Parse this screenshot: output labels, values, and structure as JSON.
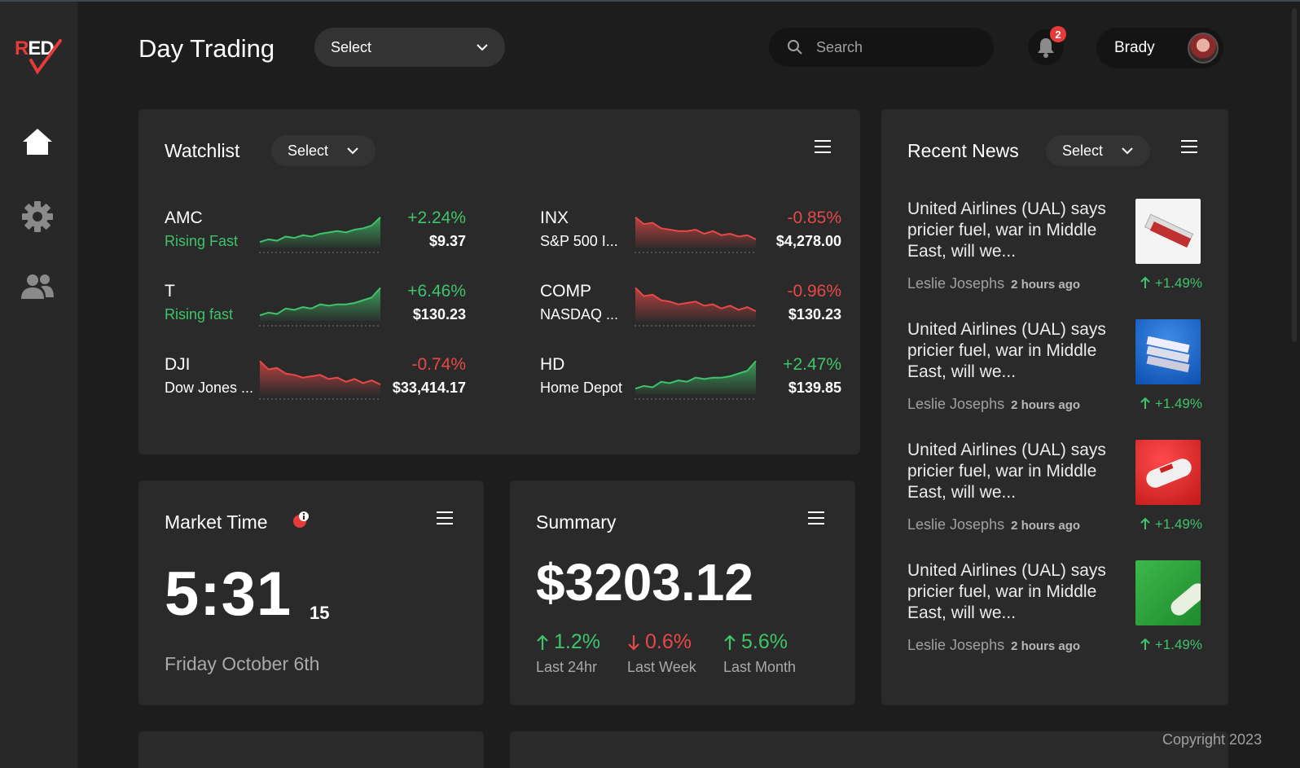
{
  "app": {
    "logo_text": "RED",
    "page_title": "Day Trading",
    "copyright": "Copyright 2023"
  },
  "sidebar": {
    "items": [
      {
        "icon": "home-icon"
      },
      {
        "icon": "gear-icon"
      },
      {
        "icon": "users-icon"
      }
    ]
  },
  "header": {
    "select_label": "Select",
    "search_placeholder": "Search",
    "notifications_count": "2",
    "user_name": "Brady"
  },
  "watchlist": {
    "title": "Watchlist",
    "select_label": "Select",
    "items": [
      {
        "symbol": "AMC",
        "subtitle": "Rising Fast",
        "change": "+2.24%",
        "price": "$9.37",
        "trend": "up",
        "spark": [
          4,
          6,
          5,
          8,
          7,
          9,
          8,
          10,
          11,
          12,
          11,
          13,
          14,
          16,
          22
        ]
      },
      {
        "symbol": "INX",
        "subtitle": "S&P 500 I...",
        "change": "-0.85%",
        "price": "$4,278.00",
        "trend": "down",
        "spark": [
          22,
          17,
          18,
          14,
          13,
          12,
          12,
          13,
          10,
          12,
          9,
          10,
          8,
          9,
          6
        ]
      },
      {
        "symbol": "T",
        "subtitle": "Rising fast",
        "change": "+6.46%",
        "price": "$130.23",
        "trend": "up",
        "spark": [
          4,
          6,
          5,
          9,
          8,
          10,
          9,
          12,
          11,
          12,
          12,
          13,
          15,
          17,
          24
        ]
      },
      {
        "symbol": "COMP",
        "subtitle": "NASDAQ ...",
        "change": "-0.96%",
        "price": "$130.23",
        "trend": "down",
        "spark": [
          24,
          18,
          19,
          15,
          14,
          12,
          13,
          14,
          11,
          12,
          9,
          11,
          8,
          10,
          7
        ]
      },
      {
        "symbol": "DJI",
        "subtitle": "Dow Jones ...",
        "change": "-0.74%",
        "price": "$33,414.17",
        "trend": "down",
        "spark": [
          24,
          18,
          19,
          15,
          14,
          12,
          13,
          14,
          11,
          12,
          9,
          11,
          8,
          10,
          7
        ]
      },
      {
        "symbol": "HD",
        "subtitle": "Home Depot",
        "change": "+2.47%",
        "price": "$139.85",
        "trend": "up",
        "spark": [
          4,
          6,
          5,
          9,
          8,
          10,
          9,
          12,
          11,
          12,
          12,
          13,
          15,
          17,
          24
        ]
      }
    ]
  },
  "market_time": {
    "title": "Market Time",
    "time": "5:31",
    "seconds": "15",
    "date": "Friday October 6th"
  },
  "summary": {
    "title": "Summary",
    "total": "$3203.12",
    "stats": [
      {
        "value": "1.2%",
        "label": "Last 24hr",
        "direction": "up"
      },
      {
        "value": "0.6%",
        "label": "Last Week",
        "direction": "down"
      },
      {
        "value": "5.6%",
        "label": "Last Month",
        "direction": "up"
      }
    ]
  },
  "news": {
    "title": "Recent News",
    "select_label": "Select",
    "items": [
      {
        "headline": "United Airlines (UAL) says pricier fuel, war in Middle East, will we...",
        "author": "Leslie Josephs",
        "time": "2 hours ago",
        "change": "+1.49%",
        "thumb": "newspaper-white"
      },
      {
        "headline": "United Airlines (UAL) says pricier fuel, war in Middle East, will we...",
        "author": "Leslie Josephs",
        "time": "2 hours ago",
        "change": "+1.49%",
        "thumb": "newspaper-blue"
      },
      {
        "headline": "United Airlines (UAL) says pricier fuel, war in Middle East, will we...",
        "author": "Leslie Josephs",
        "time": "2 hours ago",
        "change": "+1.49%",
        "thumb": "newspaper-red"
      },
      {
        "headline": "United Airlines (UAL) says pricier fuel, war in Middle East, will we...",
        "author": "Leslie Josephs",
        "time": "2 hours ago",
        "change": "+1.49%",
        "thumb": "newspaper-green"
      }
    ]
  },
  "colors": {
    "up": "#3fc46b",
    "down": "#e84848",
    "accent": "#e63b3b",
    "card": "#2a2a2a",
    "background": "#1d1d1d"
  }
}
